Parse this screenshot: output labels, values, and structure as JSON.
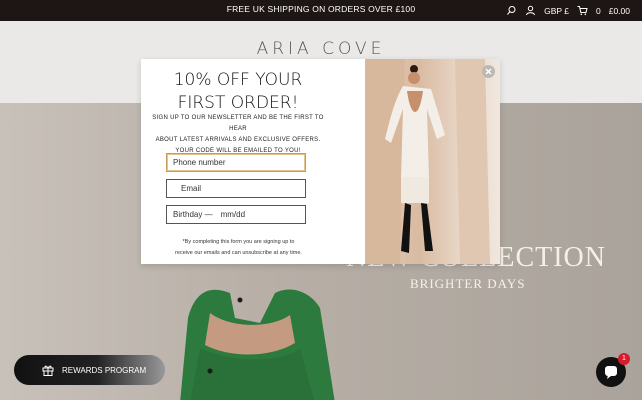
{
  "topbar": {
    "announcement": "FREE UK SHIPPING ON ORDERS OVER £100",
    "currency": "GBP £",
    "cart_count": "0",
    "cart_total": "£0.00",
    "background": "#1e1614"
  },
  "header": {
    "logo": "ARIA COVE"
  },
  "hero": {
    "title": "NEW COLLECTION",
    "subtitle": "BRIGHTER DAYS"
  },
  "popup": {
    "title_line1": "10% OFF YOUR",
    "title_line2": "FIRST ORDER!",
    "body_line1": "SIGN UP TO OUR NEWSLETTER AND BE THE FIRST TO HEAR",
    "body_line2": "ABOUT LATEST ARRIVALS AND EXCLUSIVE OFFERS.",
    "body_line3": "YOUR CODE WILL BE EMAILED TO YOU!",
    "phone_placeholder": "Phone number",
    "email_placeholder": "Email",
    "birthday_label": "Birthday —",
    "birthday_placeholder": "mm/dd",
    "fine_line1": "*By completing this form you are signing up to",
    "fine_line2": "receive our emails and can unsubscribe at any time.",
    "close_icon": "close-icon",
    "focus_color": "#c79b5a"
  },
  "rewards": {
    "label": "REWARDS PROGRAM",
    "icon": "gift-icon"
  },
  "chat": {
    "badge": "1",
    "icon": "chat-icon"
  }
}
